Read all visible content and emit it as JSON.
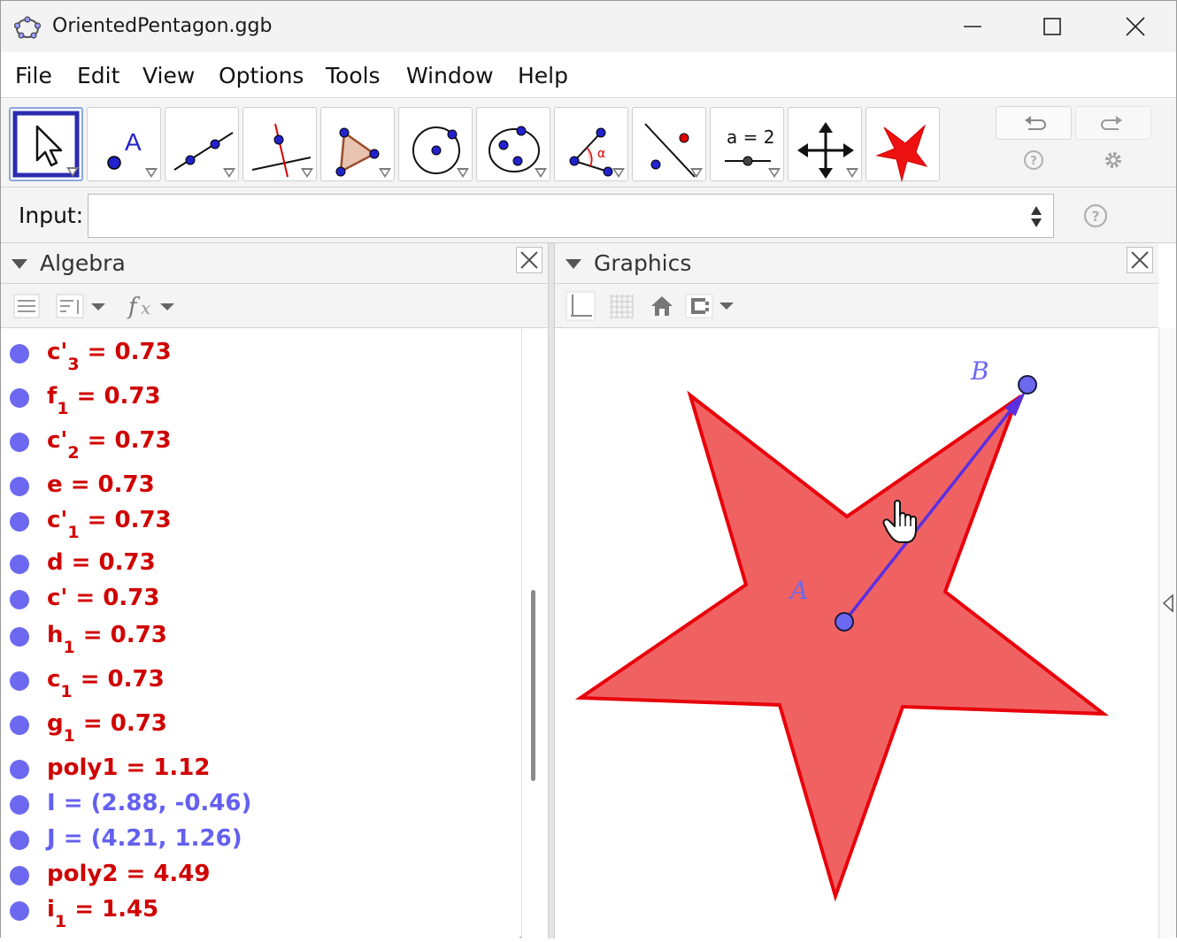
{
  "window": {
    "title": "OrientedPentagon.ggb",
    "controls": [
      "minimize",
      "maximize",
      "close"
    ]
  },
  "menu": [
    "File",
    "Edit",
    "View",
    "Options",
    "Tools",
    "Window",
    "Help"
  ],
  "toolbar": {
    "tools": [
      {
        "name": "move-tool",
        "icon": "arrow-cursor-icon",
        "selected": true
      },
      {
        "name": "point-tool",
        "icon": "point-icon",
        "label": "A"
      },
      {
        "name": "line-tool",
        "icon": "line-through-two-points-icon"
      },
      {
        "name": "perpendicular-line-tool",
        "icon": "perpendicular-line-icon"
      },
      {
        "name": "polygon-tool",
        "icon": "polygon-icon"
      },
      {
        "name": "circle-tool",
        "icon": "circle-center-point-icon"
      },
      {
        "name": "conic-tool",
        "icon": "ellipse-icon"
      },
      {
        "name": "angle-tool",
        "icon": "angle-icon",
        "label": "α"
      },
      {
        "name": "reflect-tool",
        "icon": "reflect-about-line-icon"
      },
      {
        "name": "slider-tool",
        "icon": "slider-icon",
        "label": "a = 2"
      },
      {
        "name": "move-graphics-tool",
        "icon": "move-graphics-icon"
      },
      {
        "name": "custom-star-tool",
        "icon": "red-star-icon"
      }
    ],
    "right_icons": [
      "undo-icon",
      "redo-icon",
      "help-icon",
      "settings-icon"
    ]
  },
  "input": {
    "label": "Input:",
    "value": ""
  },
  "algebra": {
    "title": "Algebra",
    "rows": [
      {
        "name": "c'",
        "sub": "3",
        "value": "0.73",
        "color": "red"
      },
      {
        "name": "f",
        "sub": "1",
        "value": "0.73",
        "color": "red"
      },
      {
        "name": "c'",
        "sub": "2",
        "value": "0.73",
        "color": "red"
      },
      {
        "name": "e",
        "sub": "",
        "value": "0.73",
        "color": "red"
      },
      {
        "name": "c'",
        "sub": "1",
        "value": "0.73",
        "color": "red"
      },
      {
        "name": "d",
        "sub": "",
        "value": "0.73",
        "color": "red"
      },
      {
        "name": "c'",
        "sub": "",
        "value": "0.73",
        "color": "red"
      },
      {
        "name": "h",
        "sub": "1",
        "value": "0.73",
        "color": "red"
      },
      {
        "name": "c",
        "sub": "1",
        "value": "0.73",
        "color": "red"
      },
      {
        "name": "g",
        "sub": "1",
        "value": "0.73",
        "color": "red"
      },
      {
        "name": "poly1",
        "sub": "",
        "value": "1.12",
        "color": "red"
      },
      {
        "name": "I",
        "sub": "",
        "value": "(2.88, -0.46)",
        "color": "blue"
      },
      {
        "name": "J",
        "sub": "",
        "value": "(4.21, 1.26)",
        "color": "blue"
      },
      {
        "name": "poly2",
        "sub": "",
        "value": "4.49",
        "color": "red"
      },
      {
        "name": "i",
        "sub": "1",
        "value": "1.45",
        "color": "red"
      }
    ]
  },
  "graphics": {
    "title": "Graphics",
    "points": [
      {
        "label": "A"
      },
      {
        "label": "B"
      }
    ],
    "colors": {
      "star_fill": "#f06262",
      "star_stroke": "#e8000b",
      "point": "#6d68f0",
      "vector": "#5a30e0"
    }
  }
}
